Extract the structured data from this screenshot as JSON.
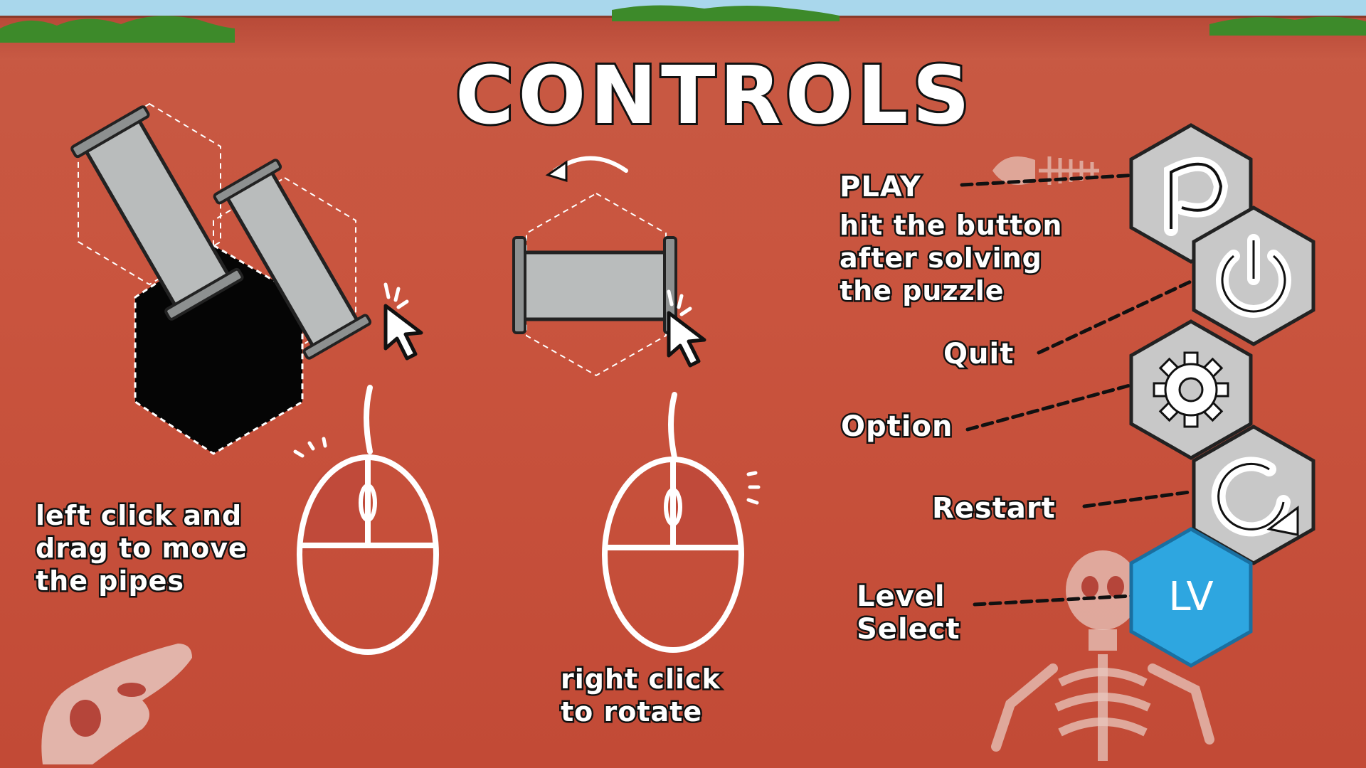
{
  "screen": {
    "title": "CONTROLS"
  },
  "instructions": {
    "move": [
      "left click and",
      "drag to move",
      "the pipes"
    ],
    "rotate": [
      "right click",
      "to rotate"
    ]
  },
  "buttons": {
    "play": {
      "label": "PLAY",
      "desc": [
        "hit the button",
        "after solving",
        "the puzzle"
      ],
      "icon": "play-p-icon"
    },
    "quit": {
      "label": "Quit",
      "icon": "power-icon"
    },
    "option": {
      "label": "Option",
      "icon": "gear-icon"
    },
    "restart": {
      "label": "Restart",
      "icon": "restart-icon"
    },
    "level_select": {
      "label": [
        "Level",
        "Select"
      ],
      "icon_text": "LV"
    }
  },
  "colors": {
    "background": "#c85a44",
    "button_gray": "#c8c8c8",
    "button_blue": "#2ea6e0",
    "pipe_gray": "#b9bcbc"
  }
}
